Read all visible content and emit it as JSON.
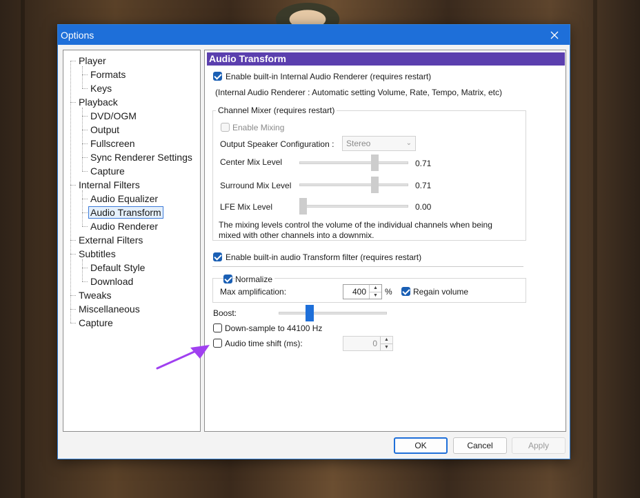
{
  "window": {
    "title": "Options"
  },
  "tree": {
    "items": [
      {
        "label": "Player",
        "level": 0
      },
      {
        "label": "Formats",
        "level": 1
      },
      {
        "label": "Keys",
        "level": 1
      },
      {
        "label": "Playback",
        "level": 0
      },
      {
        "label": "DVD/OGM",
        "level": 1
      },
      {
        "label": "Output",
        "level": 1
      },
      {
        "label": "Fullscreen",
        "level": 1
      },
      {
        "label": "Sync Renderer Settings",
        "level": 1
      },
      {
        "label": "Capture",
        "level": 1
      },
      {
        "label": "Internal Filters",
        "level": 0
      },
      {
        "label": "Audio Equalizer",
        "level": 1
      },
      {
        "label": "Audio Transform",
        "level": 1,
        "selected": true
      },
      {
        "label": "Audio Renderer",
        "level": 1
      },
      {
        "label": "External Filters",
        "level": 0
      },
      {
        "label": "Subtitles",
        "level": 0
      },
      {
        "label": "Default Style",
        "level": 1
      },
      {
        "label": "Download",
        "level": 1
      },
      {
        "label": "Tweaks",
        "level": 0
      },
      {
        "label": "Miscellaneous",
        "level": 0
      },
      {
        "label": "Capture",
        "level": 0
      }
    ]
  },
  "panel": {
    "header": "Audio Transform",
    "enable_internal_renderer": {
      "label": "Enable built-in Internal  Audio Renderer (requires restart)",
      "checked": true
    },
    "renderer_note": "(Internal Audio Renderer : Automatic setting Volume, Rate, Tempo, Matrix, etc)",
    "channel_mixer": {
      "title": "Channel Mixer (requires restart)",
      "enable_mixing": {
        "label": "Enable Mixing",
        "checked": false
      },
      "speaker_config_label": "Output Speaker Configuration :",
      "speaker_config_value": "Stereo",
      "center_mix": {
        "label": "Center Mix Level",
        "value": "0.71",
        "level": 0.71
      },
      "surround_mix": {
        "label": "Surround Mix Level",
        "value": "0.71",
        "level": 0.71
      },
      "lfe_mix": {
        "label": "LFE Mix Level",
        "value": "0.00",
        "level": 0.0
      },
      "note_line1": "The mixing levels control the volume of the individual channels when being",
      "note_line2": "mixed with other channels into a downmix."
    },
    "enable_transform_filter": {
      "label": "Enable built-in audio Transform filter (requires restart)",
      "checked": true
    },
    "normalize": {
      "label": "Normalize",
      "checked": true,
      "max_amp_label": "Max amplification:",
      "max_amp_value": "400",
      "max_amp_unit": "%",
      "regain_volume": {
        "label": "Regain volume",
        "checked": true
      }
    },
    "boost": {
      "label": "Boost:",
      "level": 0.27
    },
    "downsample": {
      "label": "Down-sample to 44100 Hz",
      "checked": false
    },
    "time_shift": {
      "label": "Audio time shift (ms):",
      "checked": false,
      "value": "0"
    }
  },
  "buttons": {
    "ok": "OK",
    "cancel": "Cancel",
    "apply": "Apply"
  },
  "colors": {
    "title_bar": "#1e6fd9",
    "header": "#5b3fae",
    "annotation_arrow": "#a040f0"
  }
}
